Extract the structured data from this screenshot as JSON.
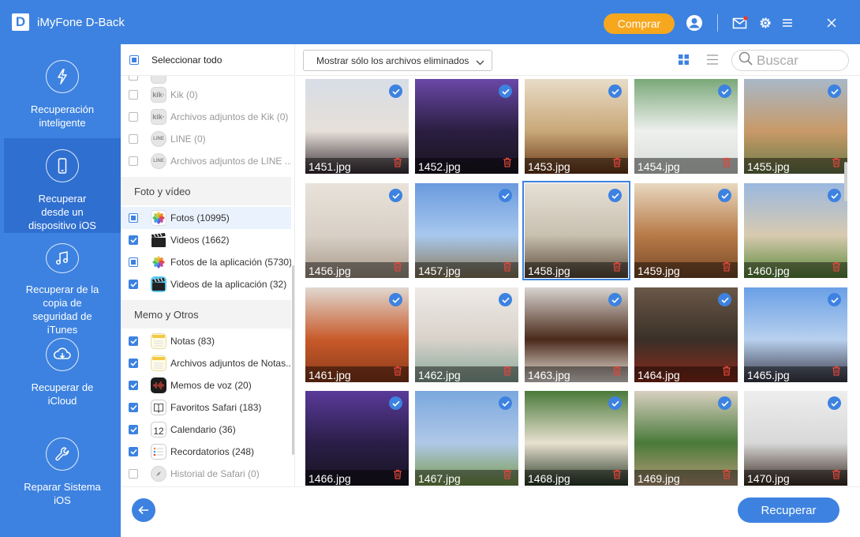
{
  "app": {
    "logo_letter": "D",
    "title": "iMyFone D-Back",
    "buy_label": "Comprar"
  },
  "sidebar": {
    "items": [
      {
        "label": "Recuperación\ninteligente",
        "icon": "lightning-icon",
        "active": false
      },
      {
        "label": "Recuperar\ndesde un\ndispositivo iOS",
        "icon": "phone-icon",
        "active": true
      },
      {
        "label": "Recuperar de la\ncopia de\nseguridad de\niTunes",
        "icon": "music-icon",
        "active": false
      },
      {
        "label": "Recuperar de\niCloud",
        "icon": "cloud-icon",
        "active": false
      },
      {
        "label": "Reparar Sistema\niOS",
        "icon": "wrench-icon",
        "active": false
      }
    ]
  },
  "categories": {
    "select_all_label": "Seleccionar todo",
    "rows_top": [
      {
        "label": "Kik (0)",
        "icon": "kik-icon",
        "icon_text": "kik·"
      },
      {
        "label": "Archivos adjuntos de Kik (0)",
        "icon": "kik-icon",
        "icon_text": "kik·"
      },
      {
        "label": "LINE (0)",
        "icon": "line-icon",
        "icon_text": "LINE"
      },
      {
        "label": "Archivos adjuntos de LINE ...",
        "icon": "line-icon",
        "icon_text": "LINE"
      }
    ],
    "section_photo": "Foto y vídeo",
    "rows_photo": [
      {
        "label": "Fotos (10995)",
        "icon": "photos-icon",
        "state": "partial",
        "selected": true
      },
      {
        "label": "Videos (1662)",
        "icon": "clapper-icon",
        "state": "checked"
      },
      {
        "label": "Fotos de la aplicación (5730)",
        "icon": "photos-icon",
        "state": "partial"
      },
      {
        "label": "Videos de la aplicación (32)",
        "icon": "clapper-icon",
        "state": "checked"
      }
    ],
    "section_memo": "Memo y Otros",
    "rows_memo": [
      {
        "label": "Notas (83)",
        "icon": "notes-icon",
        "state": "checked"
      },
      {
        "label": "Archivos adjuntos de Notas...",
        "icon": "notes-icon",
        "state": "checked"
      },
      {
        "label": "Memos de voz (20)",
        "icon": "voice-memo-icon",
        "state": "checked"
      },
      {
        "label": "Favoritos Safari (183)",
        "icon": "bookmark-icon",
        "state": "checked"
      },
      {
        "label": "Calendario (36)",
        "icon": "calendar-icon",
        "state": "checked",
        "icon_text": "12"
      },
      {
        "label": "Recordatorios (248)",
        "icon": "reminders-icon",
        "state": "checked"
      },
      {
        "label": "Historial de Safari (0)",
        "icon": "safari-icon",
        "state": "unchecked"
      }
    ]
  },
  "toolbar": {
    "filter_label": "Mostrar sólo los archivos eliminados",
    "search_placeholder": "Buscar"
  },
  "files": [
    {
      "name": "1451.jpg",
      "colors": [
        "#d8dde6",
        "#e6e0d8",
        "#3a3038"
      ]
    },
    {
      "name": "1452.jpg",
      "colors": [
        "#6a48a8",
        "#2a1e40",
        "#1a1420"
      ]
    },
    {
      "name": "1453.jpg",
      "colors": [
        "#e8dcc8",
        "#c8a878",
        "#6a3818"
      ]
    },
    {
      "name": "1454.jpg",
      "colors": [
        "#7aa878",
        "#eef0ee",
        "#d8dcd8"
      ]
    },
    {
      "name": "1455.jpg",
      "colors": [
        "#a8b8c8",
        "#c89a68",
        "#6a7a48"
      ]
    },
    {
      "name": "1456.jpg",
      "colors": [
        "#e8e2da",
        "#d8d0c6",
        "#a89a8a"
      ]
    },
    {
      "name": "1457.jpg",
      "colors": [
        "#6a9ade",
        "#a8c8ee",
        "#8a7a58"
      ]
    },
    {
      "name": "1458.jpg",
      "colors": [
        "#e6e0d6",
        "#c8c0b0",
        "#5a4a38"
      ]
    },
    {
      "name": "1459.jpg",
      "colors": [
        "#e8d8c0",
        "#b87a48",
        "#7a4a28"
      ]
    },
    {
      "name": "1460.jpg",
      "colors": [
        "#9ab8e0",
        "#d8cab0",
        "#5a8a3a"
      ]
    },
    {
      "name": "1461.jpg",
      "colors": [
        "#e0d8d0",
        "#c85a2a",
        "#8a3a1a"
      ]
    },
    {
      "name": "1462.jpg",
      "colors": [
        "#eeeae6",
        "#d8d2ca",
        "#8aa89a"
      ]
    },
    {
      "name": "1463.jpg",
      "colors": [
        "#d8d4d0",
        "#4a2a1a",
        "#eee8e0"
      ]
    },
    {
      "name": "1464.jpg",
      "colors": [
        "#6a5848",
        "#3a3028",
        "#8a2a1a"
      ]
    },
    {
      "name": "1465.jpg",
      "colors": [
        "#6aa0e6",
        "#b8d0ee",
        "#3a3a48"
      ]
    },
    {
      "name": "1466.jpg",
      "colors": [
        "#5a3a9a",
        "#2a1e48",
        "#181420"
      ]
    },
    {
      "name": "1467.jpg",
      "colors": [
        "#7aa8de",
        "#b0c8e8",
        "#7a9a4a"
      ]
    },
    {
      "name": "1468.jpg",
      "colors": [
        "#4a7a3a",
        "#e8e0d0",
        "#2a3a28"
      ]
    },
    {
      "name": "1469.jpg",
      "colors": [
        "#d8d0c0",
        "#4a7a3a",
        "#b89a78"
      ]
    },
    {
      "name": "1470.jpg",
      "colors": [
        "#eeeeee",
        "#d8d8d8",
        "#3a2a20"
      ]
    }
  ],
  "footer": {
    "recover_label": "Recuperar"
  },
  "colors": {
    "accent": "#3d82e0",
    "accent_dark": "#2f6fd0",
    "buy": "#f7a71d",
    "trash": "#e0463a"
  }
}
